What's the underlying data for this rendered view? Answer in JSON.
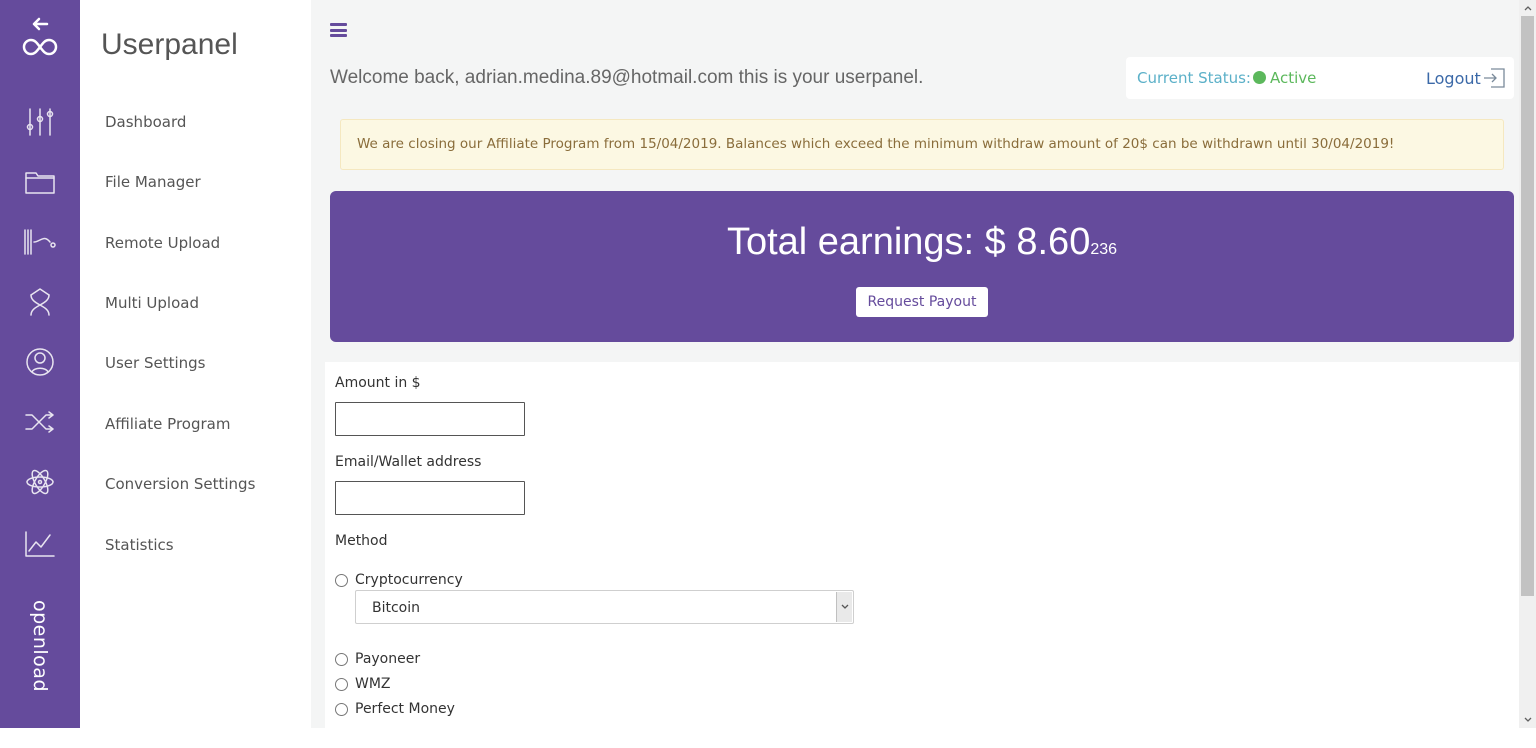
{
  "brand": {
    "name": "openload"
  },
  "nav": {
    "title": "Userpanel",
    "items": [
      {
        "label": "Dashboard"
      },
      {
        "label": "File Manager"
      },
      {
        "label": "Remote Upload"
      },
      {
        "label": "Multi Upload"
      },
      {
        "label": "User Settings"
      },
      {
        "label": "Affiliate Program"
      },
      {
        "label": "Conversion Settings"
      },
      {
        "label": "Statistics"
      }
    ]
  },
  "rail_icons": [
    "back-arrow-icon",
    "infinity-logo-icon",
    "sliders-icon",
    "folder-icon",
    "remote-upload-icon",
    "multi-upload-icon",
    "user-icon",
    "shuffle-icon",
    "atom-icon",
    "chart-icon"
  ],
  "header": {
    "welcome": "Welcome back, adrian.medina.89@hotmail.com this is your userpanel.",
    "status_label": "Current Status:",
    "status_value": "Active",
    "logout_label": "Logout"
  },
  "alert": {
    "text": "We are closing our Affiliate Program from 15/04/2019. Balances which exceed the minimum withdraw amount of 20$ can be withdrawn until 30/04/2019!"
  },
  "earnings": {
    "label": "Total earnings: $ 8.60",
    "fraction": "236",
    "payout_button": "Request Payout"
  },
  "form": {
    "amount_label": "Amount in $",
    "amount_value": "",
    "wallet_label": "Email/Wallet address",
    "wallet_value": "",
    "method_label": "Method",
    "methods": [
      {
        "label": "Cryptocurrency"
      },
      {
        "label": "Payoneer"
      },
      {
        "label": "WMZ"
      },
      {
        "label": "Perfect Money"
      }
    ],
    "crypto_selected": "Bitcoin"
  },
  "colors": {
    "primary": "#654b9c",
    "status_active": "#5cb85c",
    "alert_bg": "#fcf8e3",
    "alert_text": "#8a6d3b"
  }
}
